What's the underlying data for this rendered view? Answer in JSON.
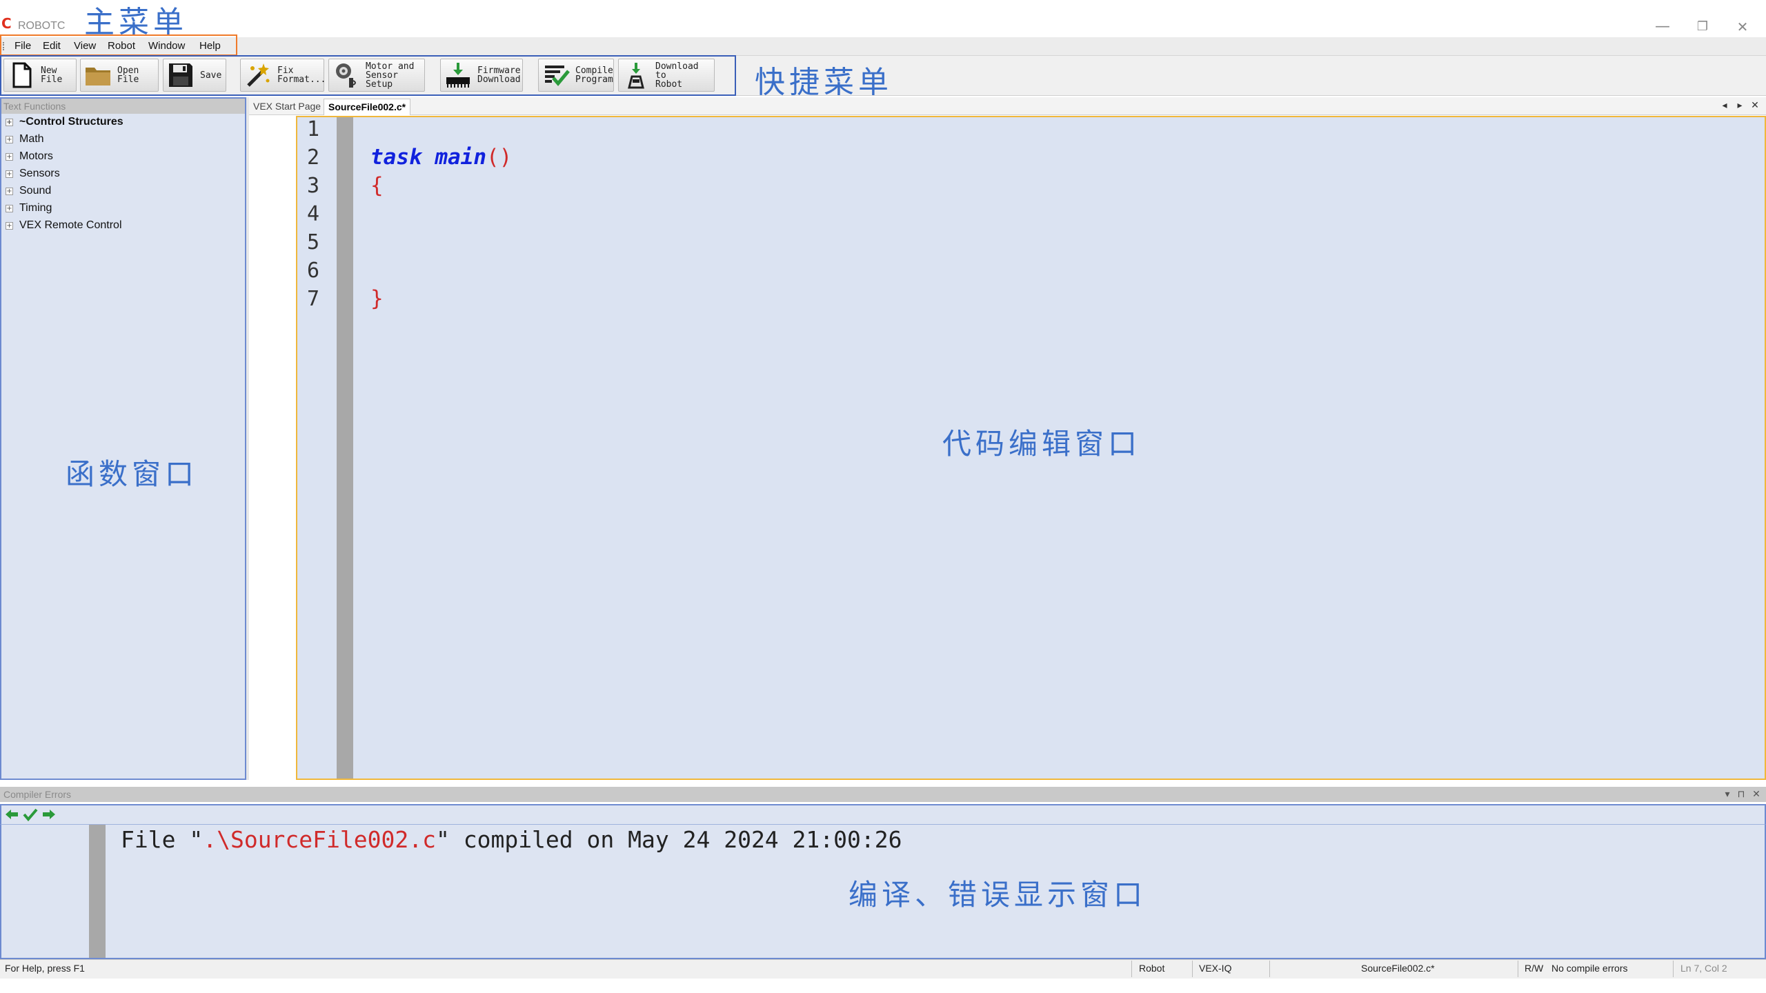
{
  "app": {
    "title": "ROBOTC",
    "logo_glyph": "C"
  },
  "window_controls": {
    "minimize": "—",
    "restore": "❐",
    "close": "✕"
  },
  "annotations": {
    "main_menu": "主菜单",
    "quick_menu": "快捷菜单",
    "function_window": "函数窗口",
    "code_edit_window": "代码编辑窗口",
    "compile_error_window": "编译、错误显示窗口"
  },
  "menu": [
    "File",
    "Edit",
    "View",
    "Robot",
    "Window",
    "Help"
  ],
  "toolbar": {
    "new_file": "New\nFile",
    "open_file": "Open\nFile",
    "save": "Save",
    "fix_format": "Fix\nFormat...",
    "motor_sensor_setup": "Motor and\nSensor\nSetup",
    "firmware_download": "Firmware\nDownload",
    "compile_program": "Compile\nProgram",
    "download_to_robot": "Download to\nRobot"
  },
  "function_panel": {
    "header": "Text Functions",
    "items": [
      "~Control Structures",
      "Math",
      "Motors",
      "Sensors",
      "Sound",
      "Timing",
      "VEX Remote Control"
    ]
  },
  "editor": {
    "tabs": [
      {
        "label": "VEX Start Page",
        "active": false
      },
      {
        "label": "SourceFile002.c*",
        "active": true
      }
    ],
    "tab_controls": {
      "prev": "◂",
      "next": "▸",
      "close": "✕"
    },
    "line_numbers": [
      "1",
      "2",
      "3",
      "4",
      "5",
      "6",
      "7"
    ],
    "code": {
      "kw_task": "task",
      "kw_main": "main",
      "parens": "()",
      "open_brace": "{",
      "close_brace": "}"
    }
  },
  "compiler_panel": {
    "header": "Compiler Errors",
    "header_controls": {
      "dropdown": "▾",
      "pin": "⊓",
      "close": "✕"
    },
    "message_prefix": "File \"",
    "message_path": ".\\SourceFile002.c",
    "message_suffix": "\" compiled on May 24 2024 21:00:26"
  },
  "statusbar": {
    "help": "For Help, press F1",
    "robot": "Robot",
    "platform": "VEX-IQ",
    "file": "SourceFile002.c*",
    "mode": "R/W",
    "errors": "No compile errors",
    "position": "Ln 7, Col 2"
  },
  "colors": {
    "annotation": "#3a6fc9",
    "menu_frame": "#f07a2a",
    "toolbar_frame": "#3a5fb8",
    "editor_frame": "#f0b73a",
    "editor_bg": "#dbe3f2",
    "keyword": "#1122dd",
    "brace": "#d02a2a"
  }
}
